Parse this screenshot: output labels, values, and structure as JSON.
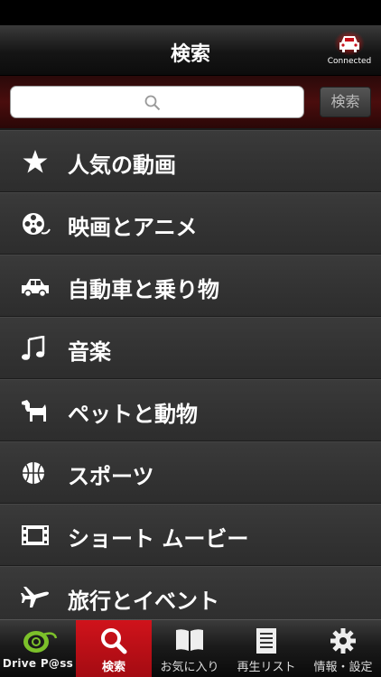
{
  "header": {
    "title": "検索",
    "connected_label": "Connected"
  },
  "search": {
    "placeholder": "",
    "button_label": "検索"
  },
  "categories": [
    {
      "label": "人気の動画",
      "icon": "star-icon"
    },
    {
      "label": "映画とアニメ",
      "icon": "film-reel-icon"
    },
    {
      "label": "自動車と乗り物",
      "icon": "car-icon"
    },
    {
      "label": "音楽",
      "icon": "music-note-icon"
    },
    {
      "label": "ペットと動物",
      "icon": "dog-icon"
    },
    {
      "label": "スポーツ",
      "icon": "basketball-icon"
    },
    {
      "label": "ショート ムービー",
      "icon": "film-strip-icon"
    },
    {
      "label": "旅行とイベント",
      "icon": "airplane-icon"
    }
  ],
  "tabs": [
    {
      "label": "Drive P@ss",
      "icon": "drivepass-logo-icon",
      "active": false
    },
    {
      "label": "検索",
      "icon": "search-icon",
      "active": true
    },
    {
      "label": "お気に入り",
      "icon": "book-icon",
      "active": false
    },
    {
      "label": "再生リスト",
      "icon": "list-icon",
      "active": false
    },
    {
      "label": "情報・設定",
      "icon": "gear-icon",
      "active": false
    }
  ],
  "colors": {
    "accent_red": "#c8101a",
    "connected_glow": "#ff3030"
  }
}
